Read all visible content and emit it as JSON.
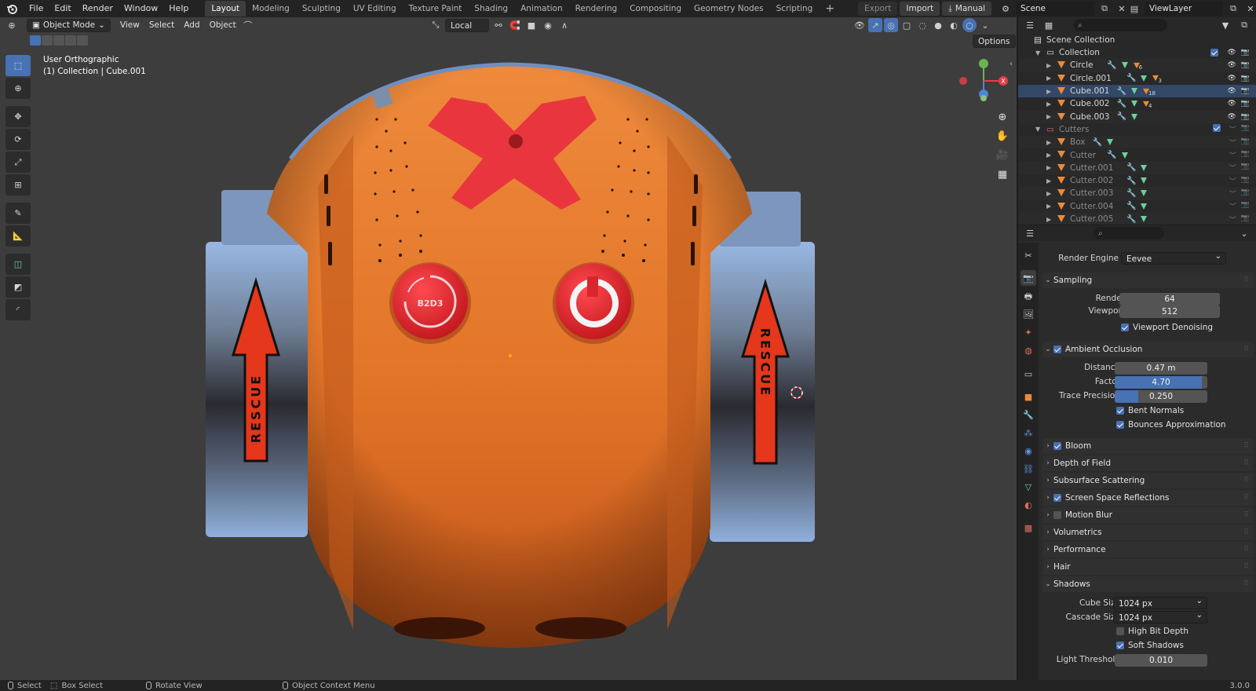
{
  "topbar": {
    "menus": [
      "File",
      "Edit",
      "Render",
      "Window",
      "Help"
    ],
    "workspaces": [
      "Layout",
      "Modeling",
      "Sculpting",
      "UV Editing",
      "Texture Paint",
      "Shading",
      "Animation",
      "Rendering",
      "Compositing",
      "Geometry Nodes",
      "Scripting"
    ],
    "active_workspace": "Layout",
    "export_label": "Export",
    "import_label": "Import",
    "manual_label": "Manual",
    "scene": "Scene",
    "view_layer": "ViewLayer"
  },
  "viewport": {
    "mode": "Object Mode",
    "menus": [
      "View",
      "Select",
      "Add",
      "Object"
    ],
    "transform_orientation": "Local",
    "options_label": "Options",
    "view_name": "User Orthographic",
    "context": "(1) Collection | Cube.001",
    "decal_left": "RESCUE",
    "decal_right": "RESCUE",
    "button_label": "B2D3",
    "colors": {
      "body": "#e07a2a",
      "accent": "#e8343c",
      "metal": "#7aa0d0",
      "background": "#3d3d3d"
    }
  },
  "outliner": {
    "root": "Scene Collection",
    "rows": [
      {
        "name": "Collection",
        "type": "collection",
        "dim": false
      },
      {
        "name": "Circle",
        "type": "object",
        "badge": "6",
        "dim": false
      },
      {
        "name": "Circle.001",
        "type": "object",
        "badge": "3",
        "dim": false
      },
      {
        "name": "Cube.001",
        "type": "object",
        "badge": "18",
        "dim": false
      },
      {
        "name": "Cube.002",
        "type": "object",
        "badge": "4",
        "dim": false
      },
      {
        "name": "Cube.003",
        "type": "object",
        "badge": "",
        "dim": false
      },
      {
        "name": "Cutters",
        "type": "collection",
        "dim": true
      },
      {
        "name": "Box",
        "type": "object",
        "badge": "",
        "dim": true
      },
      {
        "name": "Cutter",
        "type": "object",
        "badge": "",
        "dim": true
      },
      {
        "name": "Cutter.001",
        "type": "object",
        "badge": "",
        "dim": true
      },
      {
        "name": "Cutter.002",
        "type": "object",
        "badge": "",
        "dim": true
      },
      {
        "name": "Cutter.003",
        "type": "object",
        "badge": "",
        "dim": true
      },
      {
        "name": "Cutter.004",
        "type": "object",
        "badge": "",
        "dim": true
      },
      {
        "name": "Cutter.005",
        "type": "object",
        "badge": "",
        "dim": true
      }
    ]
  },
  "properties": {
    "render_engine_label": "Render Engine",
    "render_engine": "Eevee",
    "sampling": {
      "title": "Sampling",
      "render_label": "Render",
      "render": "64",
      "viewport_label": "Viewport",
      "viewport": "512",
      "denoise_label": "Viewport Denoising"
    },
    "ao": {
      "title": "Ambient Occlusion",
      "distance_label": "Distance",
      "distance": "0.47 m",
      "factor_label": "Factor",
      "factor": "4.70",
      "factor_fill": 0.94,
      "trace_label": "Trace Precision",
      "trace": "0.250",
      "trace_fill": 0.25,
      "bent_label": "Bent Normals",
      "bounces_label": "Bounces Approximation"
    },
    "sections": [
      {
        "title": "Bloom",
        "checkbox": true,
        "checked": true
      },
      {
        "title": "Depth of Field",
        "checkbox": false
      },
      {
        "title": "Subsurface Scattering",
        "checkbox": false
      },
      {
        "title": "Screen Space Reflections",
        "checkbox": true,
        "checked": true
      },
      {
        "title": "Motion Blur",
        "checkbox": true,
        "checked": false
      },
      {
        "title": "Volumetrics",
        "checkbox": false
      },
      {
        "title": "Performance",
        "checkbox": false
      },
      {
        "title": "Hair",
        "checkbox": false
      }
    ],
    "shadows": {
      "title": "Shadows",
      "cube_label": "Cube Size",
      "cube": "1024 px",
      "cascade_label": "Cascade Size",
      "cascade": "1024 px",
      "highbit_label": "High Bit Depth",
      "soft_label": "Soft Shadows",
      "light_label": "Light Threshold",
      "light": "0.010"
    }
  },
  "statusbar": {
    "select": "Select",
    "box_select": "Box Select",
    "rotate": "Rotate View",
    "context_menu": "Object Context Menu",
    "version": "3.0.0"
  }
}
